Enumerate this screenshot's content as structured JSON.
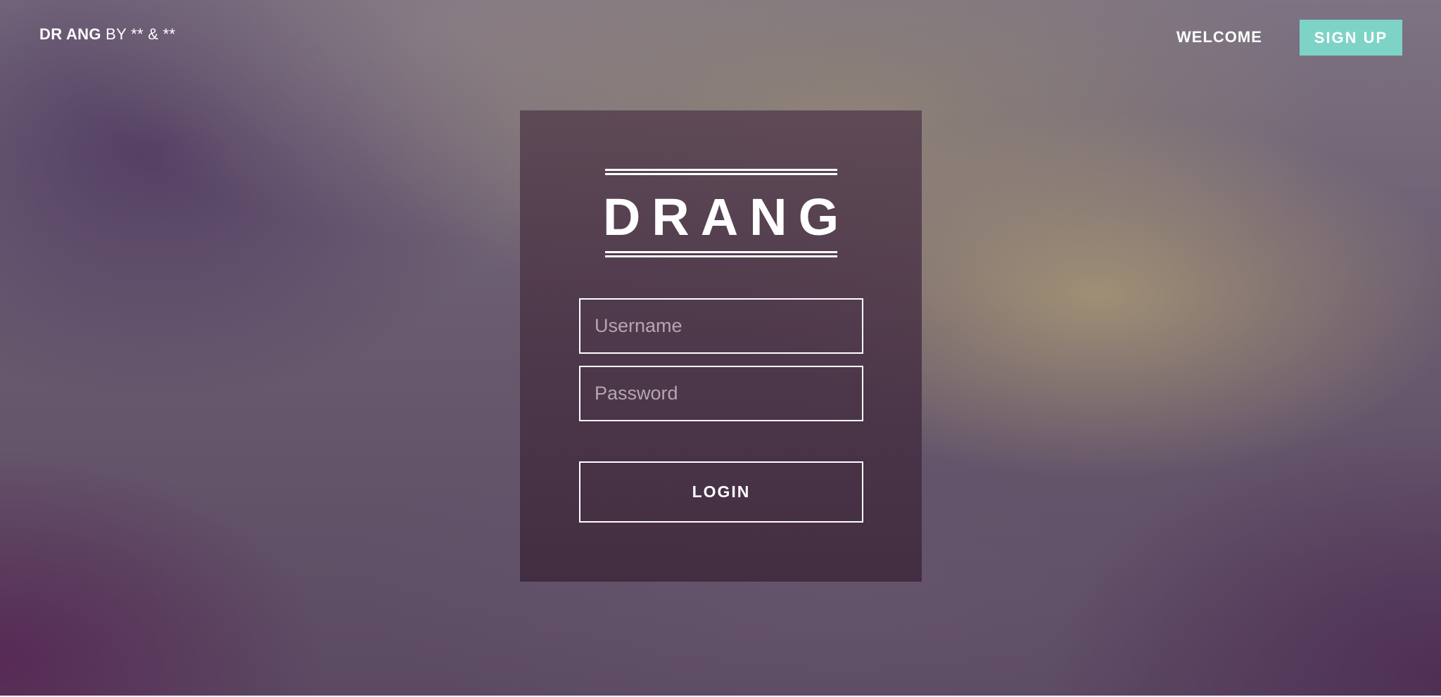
{
  "header": {
    "brand_strong": "DR ANG",
    "brand_rest": " BY ** & **",
    "nav": {
      "welcome_label": "WELCOME",
      "signup_label": "SIGN UP"
    }
  },
  "login": {
    "logo_text": "DRANG",
    "username_placeholder": "Username",
    "password_placeholder": "Password",
    "login_label": "LOGIN"
  },
  "colors": {
    "accent": "#7ed3c7",
    "card": "#4e3447",
    "text": "#ffffff"
  }
}
